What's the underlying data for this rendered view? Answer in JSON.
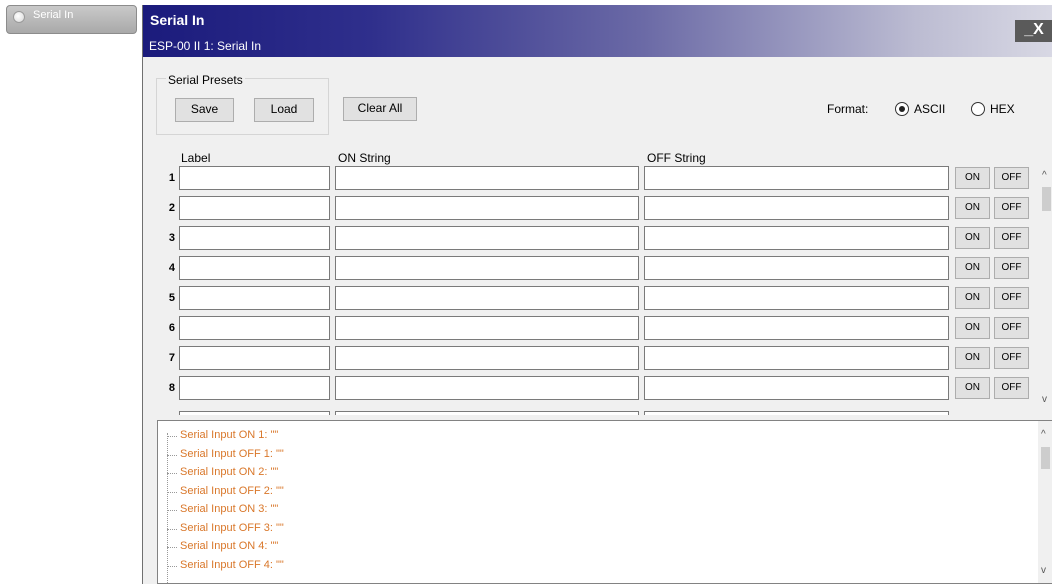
{
  "block": {
    "label": "Serial In"
  },
  "window": {
    "title": "Serial In",
    "subtitle": "ESP-00 II 1: Serial In",
    "controls": "_X"
  },
  "presets": {
    "legend": "Serial Presets",
    "save_label": "Save",
    "load_label": "Load"
  },
  "clear_all_label": "Clear All",
  "format": {
    "label": "Format:",
    "options": [
      "ASCII",
      "HEX"
    ],
    "selected": "ASCII"
  },
  "columns": {
    "label": "Label",
    "on": "ON String",
    "off": "OFF String"
  },
  "rows": [
    {
      "num": "1",
      "label": "",
      "on": "",
      "off": ""
    },
    {
      "num": "2",
      "label": "",
      "on": "",
      "off": ""
    },
    {
      "num": "3",
      "label": "",
      "on": "",
      "off": ""
    },
    {
      "num": "4",
      "label": "",
      "on": "",
      "off": ""
    },
    {
      "num": "5",
      "label": "",
      "on": "",
      "off": ""
    },
    {
      "num": "6",
      "label": "",
      "on": "",
      "off": ""
    },
    {
      "num": "7",
      "label": "",
      "on": "",
      "off": ""
    },
    {
      "num": "8",
      "label": "",
      "on": "",
      "off": ""
    }
  ],
  "row_buttons": {
    "on": "ON",
    "off": "OFF"
  },
  "log": [
    "Serial Input ON 1: \"\"",
    "Serial Input OFF 1: \"\"",
    "Serial Input ON 2: \"\"",
    "Serial Input OFF 2: \"\"",
    "Serial Input ON 3: \"\"",
    "Serial Input OFF 3: \"\"",
    "Serial Input ON 4: \"\"",
    "Serial Input OFF 4: \"\""
  ],
  "colors": {
    "log_text": "#d9772a",
    "title_gradient_start": "#1b1b7c"
  }
}
